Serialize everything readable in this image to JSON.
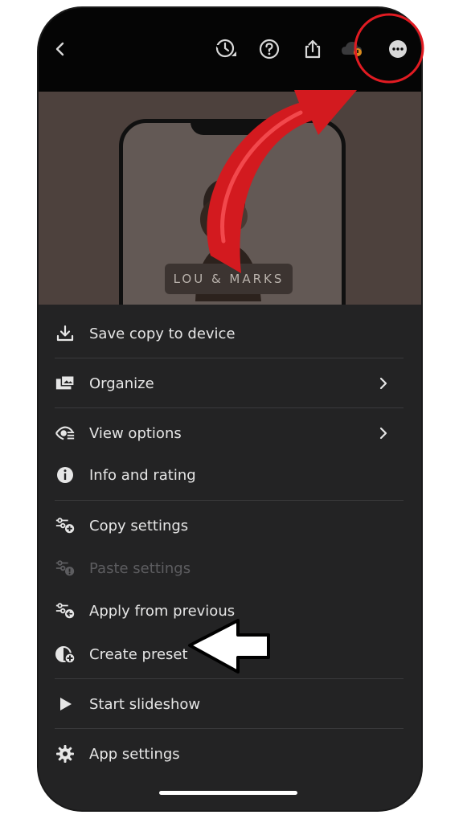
{
  "toolbar": {
    "back_icon": "chevron-left-icon",
    "history_icon": "history-icon",
    "help_icon": "help-icon",
    "share_icon": "share-icon",
    "cloud_icon": "cloud-sync-icon",
    "more_icon": "more-options-icon"
  },
  "preview": {
    "brand_label": "LOU & MARKS"
  },
  "menu": {
    "save_copy": "Save copy to device",
    "organize": "Organize",
    "view_options": "View options",
    "info_rating": "Info and rating",
    "copy_settings": "Copy settings",
    "paste_settings": "Paste settings",
    "apply_previous": "Apply from previous",
    "create_preset": "Create preset",
    "start_slideshow": "Start slideshow",
    "app_settings": "App settings"
  },
  "colors": {
    "menu_background": "#232324",
    "menu_text": "#e6e6e6",
    "disabled_text": "#5d5d60",
    "annotation_red": "#e11b22",
    "cloud_badge": "#d98a1c"
  }
}
